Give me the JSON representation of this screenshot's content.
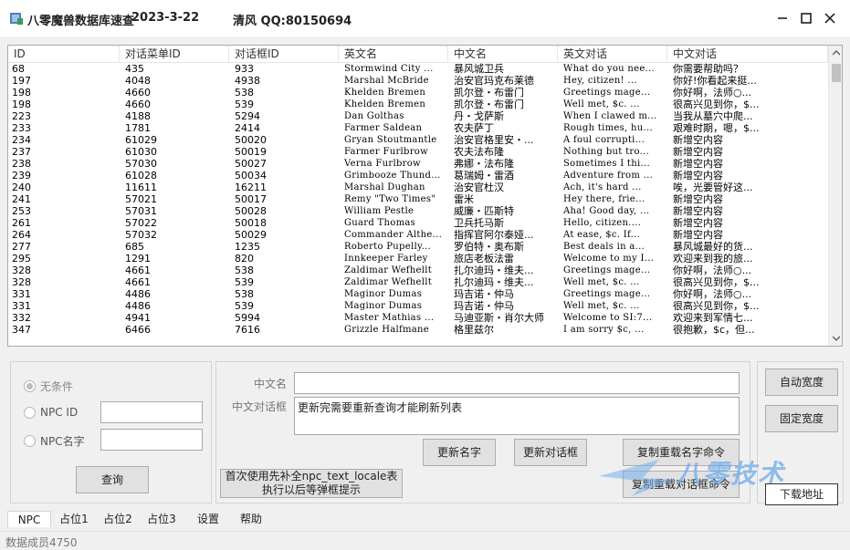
{
  "window": {
    "title": "八零魔兽数据库速查",
    "date": "2023-3-22",
    "author": "清风 QQ:80150694"
  },
  "columns": [
    "ID",
    "对话菜单ID",
    "对话框ID",
    "英文名",
    "中文名",
    "英文对话",
    "中文对话"
  ],
  "rows": [
    [
      "68",
      "435",
      "933",
      "Stormwind City ...",
      "暴风城卫兵",
      "What do you nee...",
      "你需要帮助吗？"
    ],
    [
      "197",
      "4048",
      "4938",
      "Marshal McBride",
      "治安官玛克布莱德",
      "Hey, citizen!  ...",
      "你好!你看起来挺..."
    ],
    [
      "198",
      "4660",
      "538",
      "Khelden Bremen",
      "凯尔登・布雷门",
      "Greetings mage...",
      "你好啊，法师○..."
    ],
    [
      "198",
      "4660",
      "539",
      "Khelden Bremen",
      "凯尔登・布雷门",
      "Well met, $c.  ...",
      "很高兴见到你，$..."
    ],
    [
      "223",
      "4188",
      "5294",
      "Dan Golthas",
      "丹・戈萨斯",
      "When I clawed m...",
      "当我从墓穴中爬..."
    ],
    [
      "233",
      "1781",
      "2414",
      "Farmer Saldean",
      "农夫萨丁",
      "Rough times, hu...",
      "艰难时期，嗯，$..."
    ],
    [
      "234",
      "61029",
      "50020",
      "Gryan Stoutmantle",
      "治安官格里安・...",
      "A foul corrupti...",
      "新增空内容"
    ],
    [
      "237",
      "61030",
      "50019",
      "Farmer Furlbrow",
      "农夫法布隆",
      "Nothing but tro...",
      "新增空内容"
    ],
    [
      "238",
      "57030",
      "50027",
      "Verna Furlbrow",
      "弗娜・法布隆",
      "Sometimes I thi...",
      "新增空内容"
    ],
    [
      "239",
      "61028",
      "50034",
      "Grimbooze Thund...",
      "葛瑞姆・雷酒",
      "Adventure from ...",
      "新增空内容"
    ],
    [
      "240",
      "11611",
      "16211",
      "Marshal Dughan",
      "治安官杜汉",
      "Ach, it's hard ...",
      "唉，光要管好这..."
    ],
    [
      "241",
      "57021",
      "50017",
      "Remy \"Two Times\"",
      "雷米",
      "Hey there, frie...",
      "新增空内容"
    ],
    [
      "253",
      "57031",
      "50028",
      "William Pestle",
      "威廉・匹斯特",
      "Aha! Good day, ...",
      "新增空内容"
    ],
    [
      "261",
      "57022",
      "50018",
      "Guard Thomas",
      "卫兵托马斯",
      "Hello, citizen....",
      "新增空内容"
    ],
    [
      "264",
      "57032",
      "50029",
      "Commander Althe...",
      "指挥官阿尔泰娅...",
      "At ease, $c. If...",
      "新增空内容"
    ],
    [
      "277",
      "685",
      "1235",
      "Roberto Pupelly...",
      "罗伯特・奥布斯",
      "Best deals in a...",
      "暴风城最好的货..."
    ],
    [
      "295",
      "1291",
      "820",
      "Innkeeper Farley",
      "旅店老板法雷",
      "Welcome to my I...",
      "欢迎来到我的旅..."
    ],
    [
      "328",
      "4661",
      "538",
      "Zaldimar Wefhellt",
      "扎尔迪玛・维夫...",
      "Greetings mage...",
      "你好啊，法师○..."
    ],
    [
      "328",
      "4661",
      "539",
      "Zaldimar Wefhellt",
      "扎尔迪玛・维夫...",
      "Well met, $c.  ...",
      "很高兴见到你，$..."
    ],
    [
      "331",
      "4486",
      "538",
      "Maginor Dumas",
      "玛吉诺・仲马",
      "Greetings mage...",
      "你好啊，法师○..."
    ],
    [
      "331",
      "4486",
      "539",
      "Maginor Dumas",
      "玛吉诺・仲马",
      "Well met, $c.  ...",
      "很高兴见到你，$..."
    ],
    [
      "332",
      "4941",
      "5994",
      "Master Mathias ...",
      "马迪亚斯・肖尔大师",
      "Welcome to SI:7...",
      "欢迎来到军情七..."
    ],
    [
      "347",
      "6466",
      "7616",
      "Grizzle Halfmane",
      "格里兹尔",
      "I am sorry $c, ...",
      "很抱歉，$c，但..."
    ]
  ],
  "filter": {
    "no_condition": "无条件",
    "npc_id": "NPC ID",
    "npc_name": "NPC名字",
    "npc_id_value": "",
    "npc_name_value": "",
    "query": "查询"
  },
  "edit": {
    "cn_name_label": "中文名",
    "cn_name_value": "",
    "cn_dialog_label": "中文对话框",
    "cn_dialog_value": "更新完需要重新查询才能刷新列表",
    "update_name": "更新名字",
    "update_dialog": "更新对话框",
    "copy_reload_name": "复制重载名字命令",
    "copy_reload_dialog": "复制重载对话框命令",
    "tip_line1": "首次使用先补全npc_text_locale表",
    "tip_line2": "执行以后等弹框提示"
  },
  "side": {
    "auto_width": "自动宽度",
    "fixed_width": "固定宽度",
    "download": "下载地址"
  },
  "watermark": "八零技术",
  "tabs": [
    "NPC",
    "占位1",
    "占位2",
    "占位3",
    "设置",
    "帮助"
  ],
  "status": "数据成员4750"
}
